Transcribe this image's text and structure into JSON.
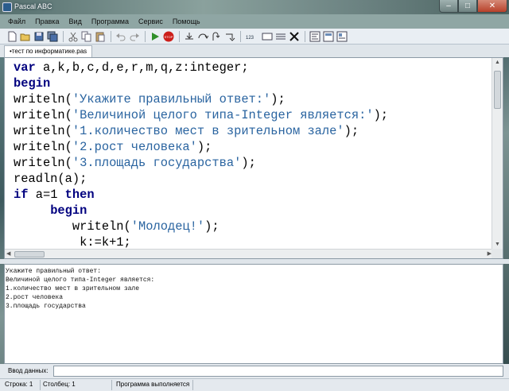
{
  "window": {
    "title": "Pascal ABC",
    "minimize": "–",
    "maximize": "□",
    "close": "✕"
  },
  "menu": [
    "Файл",
    "Правка",
    "Вид",
    "Программа",
    "Сервис",
    "Помощь"
  ],
  "toolbar": {
    "stop_label": "STOP",
    "numbers_label": "123"
  },
  "tab": {
    "label": "•тест по информатике.pas"
  },
  "editor": {
    "lines": [
      [
        {
          "t": "var",
          "c": "kw"
        },
        {
          "t": " a,k,b,c,d,e,r,m,q,z:integer;",
          "c": "plain"
        }
      ],
      [
        {
          "t": "begin",
          "c": "kw"
        }
      ],
      [
        {
          "t": "writeln(",
          "c": "plain"
        },
        {
          "t": "'Укажите правильный ответ:'",
          "c": "str"
        },
        {
          "t": ");",
          "c": "plain"
        }
      ],
      [
        {
          "t": "writeln(",
          "c": "plain"
        },
        {
          "t": "'Величиной целого типа-Integer является:'",
          "c": "str"
        },
        {
          "t": ");",
          "c": "plain"
        }
      ],
      [
        {
          "t": "writeln(",
          "c": "plain"
        },
        {
          "t": "'1.количество мест в зрительном зале'",
          "c": "str"
        },
        {
          "t": ");",
          "c": "plain"
        }
      ],
      [
        {
          "t": "writeln(",
          "c": "plain"
        },
        {
          "t": "'2.рост человека'",
          "c": "str"
        },
        {
          "t": ");",
          "c": "plain"
        }
      ],
      [
        {
          "t": "writeln(",
          "c": "plain"
        },
        {
          "t": "'3.площадь государства'",
          "c": "str"
        },
        {
          "t": ");",
          "c": "plain"
        }
      ],
      [
        {
          "t": "readln(a);",
          "c": "plain"
        }
      ],
      [
        {
          "t": "if",
          "c": "kw"
        },
        {
          "t": " a=1 ",
          "c": "plain"
        },
        {
          "t": "then",
          "c": "kw"
        }
      ],
      [
        {
          "t": "     ",
          "c": "plain"
        },
        {
          "t": "begin",
          "c": "kw"
        }
      ],
      [
        {
          "t": "        writeln(",
          "c": "plain"
        },
        {
          "t": "'Молодец!'",
          "c": "str"
        },
        {
          "t": ");",
          "c": "plain"
        }
      ],
      [
        {
          "t": "         k:=k+1;",
          "c": "plain"
        }
      ]
    ]
  },
  "output": {
    "lines": [
      "Укажите правильный ответ:",
      "Величиной целого типа-Integer является:",
      "1.количество мест в зрительном зале",
      "2.рост человека",
      "3.площадь государства"
    ]
  },
  "input_row": {
    "label": "Ввод данных:",
    "value": ""
  },
  "status": {
    "line": "Строка: 1",
    "column": "Столбец: 1",
    "state": "Программа выполняется"
  },
  "colors": {
    "keyword": "#00007f",
    "string": "#2a64a0",
    "stop_button": "#cc1f1a",
    "run_button": "#2f8f2a"
  }
}
